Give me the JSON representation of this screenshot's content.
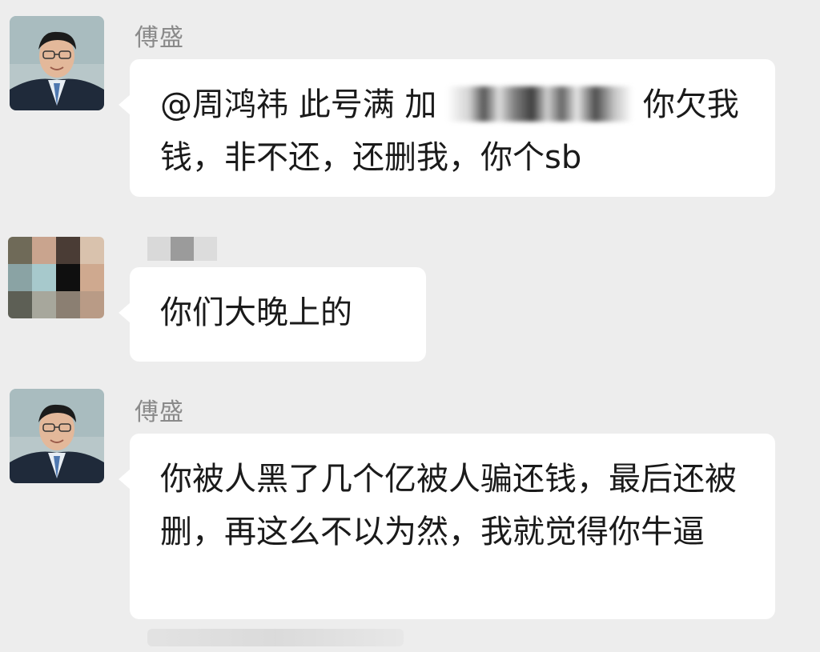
{
  "messages": [
    {
      "sender": "傅盛",
      "text_before_redaction": "@周鸿祎 此号满 加 ",
      "text_after_redaction": " 你欠我钱，非不还，还删我，你个sb"
    },
    {
      "sender": "",
      "text": "你们大晚上的"
    },
    {
      "sender": "傅盛",
      "text": "你被人黑了几个亿被人骗还钱，最后还被删，再这么不以为然，我就觉得你牛逼"
    }
  ],
  "colors": {
    "background": "#ededed",
    "bubble": "#ffffff",
    "name_text": "#8a8a8a",
    "message_text": "#1a1a1a"
  },
  "icons": [
    "user-avatar-photo",
    "pixelated-avatar"
  ]
}
